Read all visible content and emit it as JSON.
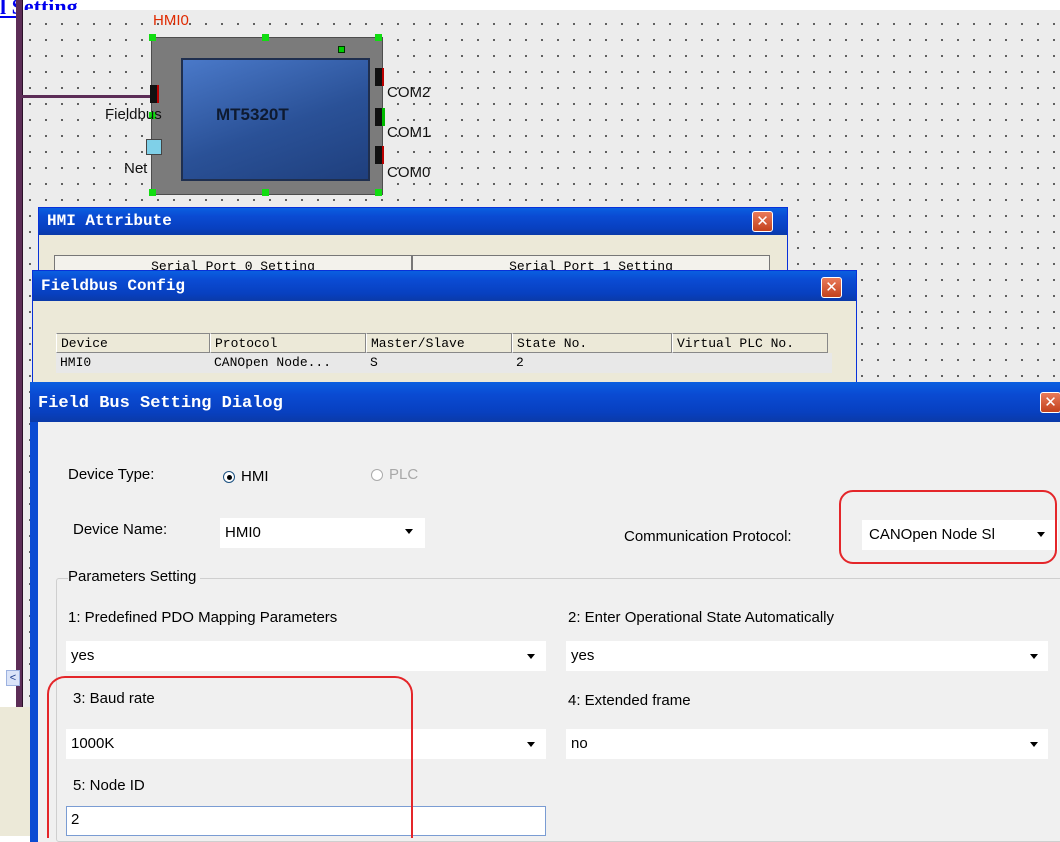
{
  "heading_fragment": "l Setting",
  "device": {
    "name": "HMI0",
    "model": "MT5320T",
    "ports": [
      "COM2",
      "COM1",
      "COM0"
    ],
    "left_labels": [
      "Fieldbus",
      "Net"
    ]
  },
  "hmi_attribute": {
    "title": "HMI Attribute",
    "tabs": [
      "Serial Port 0 Setting",
      "Serial Port 1 Setting"
    ]
  },
  "fieldbus_config": {
    "title": "Fieldbus Config",
    "columns": [
      "Device",
      "Protocol",
      "Master/Slave",
      "State No.",
      "Virtual PLC No."
    ],
    "rows": [
      [
        "HMI0",
        "CANOpen Node...",
        "S",
        "2",
        ""
      ]
    ]
  },
  "dialog": {
    "title": "Field Bus Setting Dialog",
    "device_type_label": "Device Type:",
    "device_type_options": [
      "HMI",
      "PLC"
    ],
    "device_type_selected": "HMI",
    "device_name_label": "Device Name:",
    "device_name_value": "HMI0",
    "protocol_label": "Communication Protocol:",
    "protocol_value": "CANOpen Node Sl",
    "group_title": "Parameters Setting",
    "params": {
      "p1_label": "1: Predefined PDO Mapping Parameters",
      "p1_value": "yes",
      "p2_label": "2: Enter Operational State Automatically",
      "p2_value": "yes",
      "p3_label": "3: Baud rate",
      "p3_value": "1000K",
      "p4_label": "4: Extended frame",
      "p4_value": "no",
      "p5_label": "5: Node ID",
      "p5_value": "2"
    }
  },
  "icons": {
    "close": "close-icon",
    "dropdown": "chevron-down-icon",
    "scroll": "scroll-left-icon"
  },
  "colors": {
    "titlebar": "#0a4bd3",
    "highlight": "#e4262a",
    "wire": "#5c2d57",
    "handle": "#11dd11"
  }
}
